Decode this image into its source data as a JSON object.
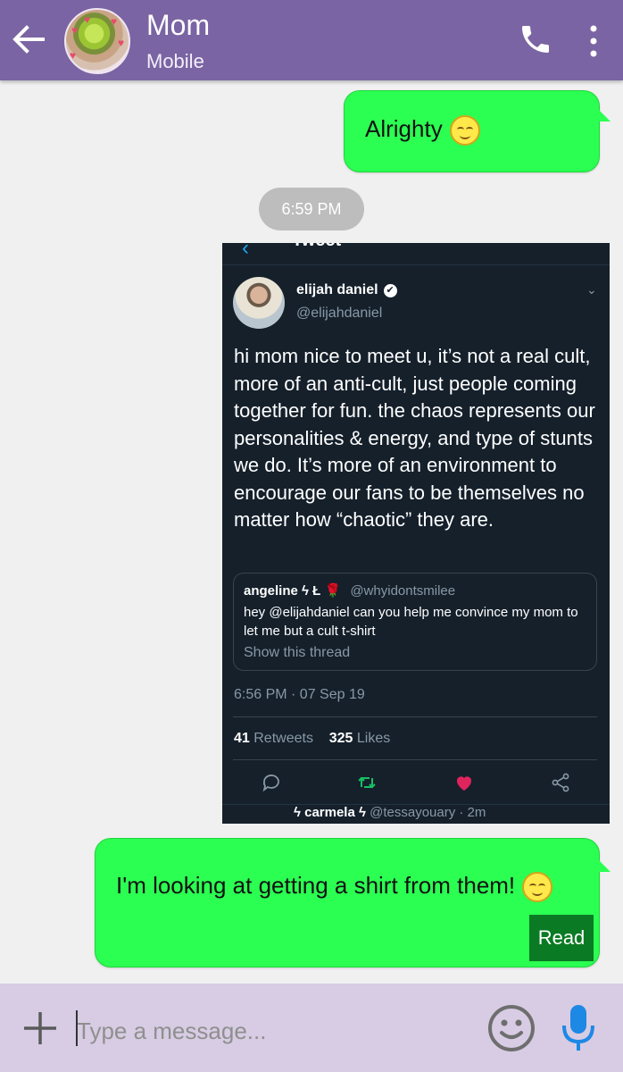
{
  "header": {
    "contact_name": "Mom",
    "contact_sub": "Mobile",
    "bg_color": "#7a64a3",
    "icons": [
      "arrow-back-icon",
      "phone-icon",
      "more-vert-icon"
    ]
  },
  "messages": [
    {
      "type": "outgoing",
      "text": "Alrighty",
      "emoji": "smiling-face-icon"
    },
    {
      "type": "timestamp",
      "text": "6:59 PM"
    },
    {
      "type": "outgoing-image",
      "image": "tweet-screenshot"
    },
    {
      "type": "outgoing",
      "text": "I'm looking at getting a shirt from them!",
      "emoji": "smiling-face-icon",
      "status": "Read"
    }
  ],
  "bubble_color": "#2bff52",
  "tweet": {
    "header_title": "Tweet",
    "author_name": "elijah daniel",
    "author_handle": "@elijahdaniel",
    "text": "hi mom nice to meet u, it’s not a real cult, more of an anti-cult, just people coming together for fun. the chaos represents our personalities & energy, and type of stunts we do. It’s more of an environment to encourage our fans to be themselves no matter how “chaotic” they are.",
    "quote": {
      "name": "angeline ϟ Ł",
      "handle": "@whyidontsmilee",
      "text": "hey @elijahdaniel can you help me convince my mom to let me but a cult t-shirt",
      "show_thread": "Show this thread"
    },
    "time": "6:56 PM · 07 Sep 19",
    "retweets_count": "41",
    "retweets_label": "Retweets",
    "likes_count": "325",
    "likes_label": "Likes",
    "next_reply_name": "ϟ carmela ϟ",
    "next_reply_handle": "@tessayouary · 2m",
    "bg_color": "#15202b"
  },
  "input": {
    "placeholder": "Type a message..."
  },
  "input_bar_color": "#d7cce3"
}
